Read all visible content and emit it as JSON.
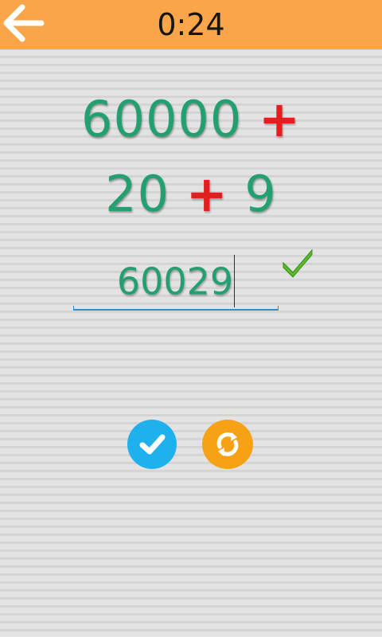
{
  "header": {
    "timer": "0:24",
    "icons": {
      "back": "arrow-left-icon"
    },
    "colors": {
      "bar": "#f9a54a",
      "back_icon": "#ffffff"
    }
  },
  "question": {
    "line1": {
      "number": "60000",
      "operator": "+"
    },
    "line2": {
      "number_a": "20",
      "operator": "+",
      "number_b": "9"
    },
    "colors": {
      "number": "#22a070",
      "operator": "#e41e1e"
    }
  },
  "answer": {
    "value": "60029",
    "status_icon": "checkmark-icon",
    "status_color": "#5ab82a",
    "underline_color": "#2d8fd0"
  },
  "actions": {
    "submit": {
      "icon": "checkmark-icon",
      "color": "#1fb0ee"
    },
    "reset": {
      "icon": "refresh-icon",
      "color": "#f7a114"
    }
  }
}
